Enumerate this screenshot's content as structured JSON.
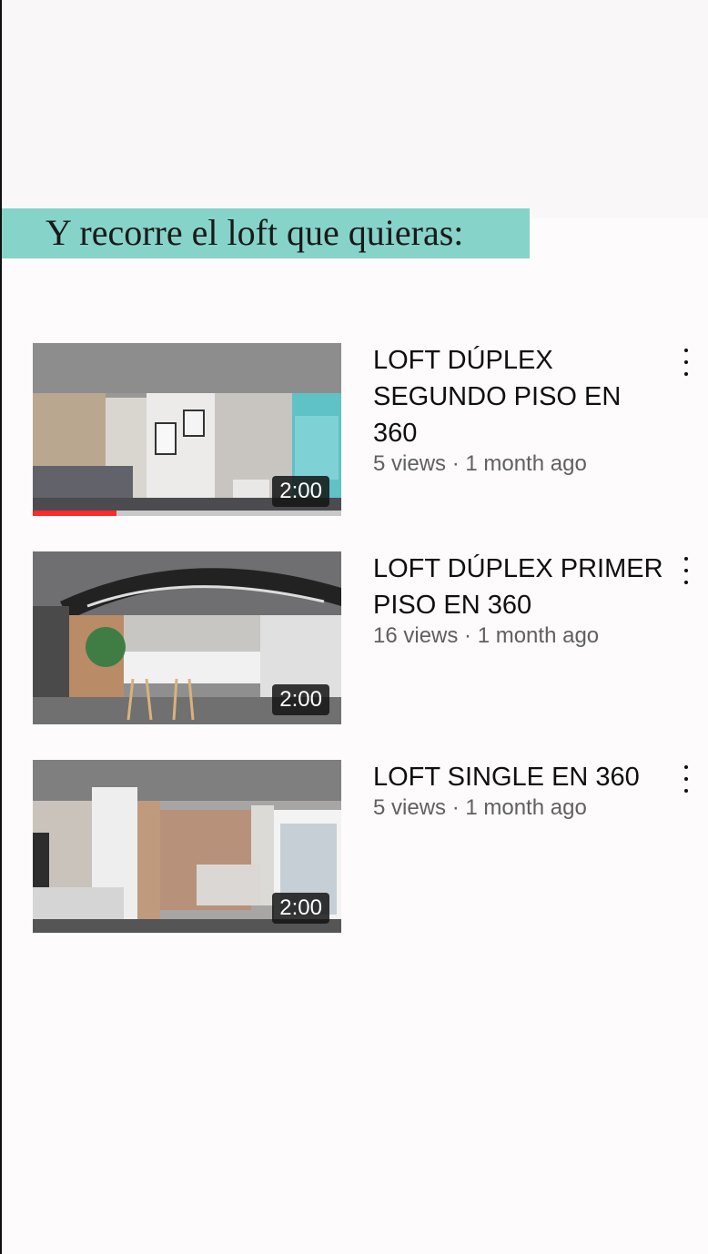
{
  "banner": {
    "text": "Y recorre el loft que quieras:",
    "background": "#86d3c9"
  },
  "videos": [
    {
      "title": "LOFT DÚPLEX SEGUNDO PISO EN 360",
      "meta": "5 views · 1 month ago",
      "duration": "2:00",
      "watched_fraction": 0.27,
      "scene": "bedroom-loft-upper-floor"
    },
    {
      "title": "LOFT DÚPLEX PRIMER PISO EN 360",
      "meta": "16 views · 1 month ago",
      "duration": "2:00",
      "scene": "kitchen-loft-ground-floor"
    },
    {
      "title": "LOFT SINGLE EN 360",
      "meta": "5 views · 1 month ago",
      "duration": "2:00",
      "scene": "single-loft-living-area"
    }
  ],
  "icons": {
    "more": "more-vert-icon"
  },
  "colors": {
    "progress": "#ff2a2a",
    "accent": "#86d3c9"
  }
}
